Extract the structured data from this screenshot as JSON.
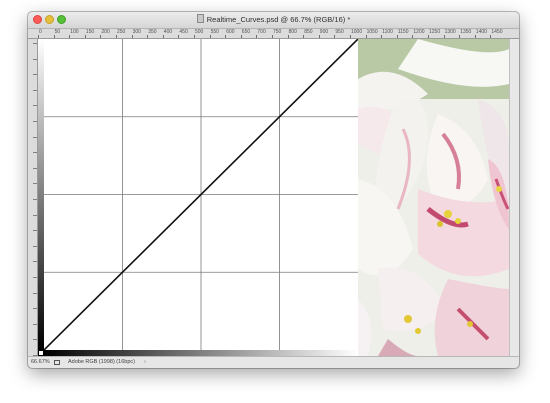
{
  "window": {
    "title": "Realtime_Curves.psd @ 66.7% (RGB/16) *"
  },
  "ruler": {
    "top_labels": [
      "0",
      "50",
      "100",
      "150",
      "200",
      "250",
      "300",
      "350",
      "400",
      "450",
      "500",
      "550",
      "600",
      "650",
      "700",
      "750",
      "800",
      "850",
      "900",
      "950",
      "1000",
      "1050",
      "1100",
      "1150",
      "1200",
      "1250",
      "1300",
      "1350",
      "1400",
      "1450"
    ]
  },
  "canvas": {
    "curve_points": [
      [
        0,
        0
      ],
      [
        255,
        255
      ]
    ]
  },
  "status": {
    "zoom": "66.67%",
    "profile": "Adobe RGB (1998) (16bpc)"
  },
  "icons": {
    "document": "document-icon",
    "export": "export-icon",
    "chevron": "chevron-right-icon"
  },
  "colors": {
    "close": "#fc5b57",
    "minimize": "#e5bf3c",
    "maximize": "#57c038"
  }
}
